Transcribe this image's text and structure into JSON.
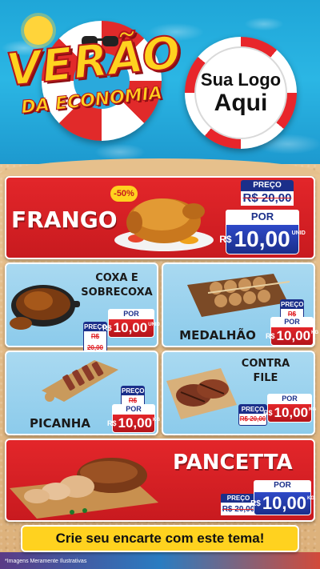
{
  "header": {
    "title_line1": "VERÃO",
    "title_line2": "DA ECONOMIA",
    "logo_line1": "Sua Logo",
    "logo_line2": "Aqui"
  },
  "frango": {
    "name": "FRANGO",
    "badge": "-50%",
    "preco_label": "PREÇO",
    "old_price": "R$ 20,00",
    "por_label": "POR",
    "currency": "R$",
    "price": "10,00",
    "unit": "UNID"
  },
  "coxa": {
    "name_l1": "COXA E",
    "name_l2": "SOBRECOXA",
    "preco_label": "PREÇO",
    "old_price": "R$ 20,00",
    "por_label": "POR",
    "currency": "R$",
    "price": "10,00",
    "unit": "UNID"
  },
  "medalhao": {
    "name": "MEDALHÃO",
    "preco_label": "PREÇO",
    "old_price": "R$ 20,00",
    "por_label": "POR",
    "currency": "R$",
    "price": "10,00",
    "unit": "KG"
  },
  "picanha": {
    "name": "PICANHA",
    "preco_label": "PREÇO",
    "old_price": "R$ 20,00",
    "por_label": "POR",
    "currency": "R$",
    "price": "10,00",
    "unit": "KG"
  },
  "contrafile": {
    "name_l1": "CONTRA",
    "name_l2": "FILE",
    "preco_label": "PREÇO",
    "old_price": "R$ 20,00",
    "por_label": "POR",
    "currency": "R$",
    "price": "10,00",
    "unit": "KG"
  },
  "pancetta": {
    "name": "PANCETTA",
    "preco_label": "PREÇO",
    "old_price": "R$ 20,00",
    "por_label": "POR",
    "currency": "R$",
    "price": "10,00",
    "unit": "KG"
  },
  "footer": {
    "cta": "Crie seu encarte com este tema!",
    "disclaimer": "*Imagens Meramente Ilustrativas"
  },
  "colors": {
    "red": "#e3262a",
    "blue_dark": "#1b2f8a",
    "panel_blue": "#a9d9f1",
    "yellow": "#ffd21f"
  }
}
